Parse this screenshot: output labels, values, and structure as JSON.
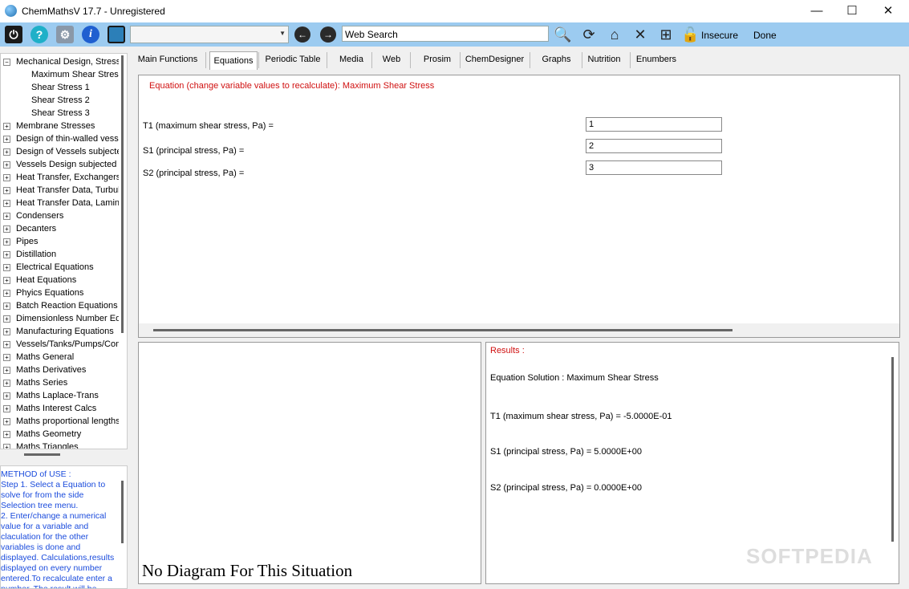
{
  "window": {
    "title": "ChemMathsV 17.7 - Unregistered",
    "minimize": "—",
    "maximize": "☐",
    "close": "✕"
  },
  "toolbar": {
    "search_value": "Web Search",
    "insecure_label": "Insecure",
    "done_label": "Done",
    "icons": [
      "power-icon",
      "help-icon",
      "settings-icon",
      "info-icon",
      "monitor-icon",
      "back-icon",
      "forward-icon",
      "search-icon",
      "refresh-icon",
      "home-icon",
      "stop-icon",
      "new-tab-icon",
      "unlock-icon"
    ],
    "accent": "#9ccbf0"
  },
  "tree": {
    "items": [
      {
        "label": "Mechanical Design, Stress",
        "level": 0,
        "expanded": true
      },
      {
        "label": "Maximum Shear Stress",
        "level": 1
      },
      {
        "label": "Shear Stress 1",
        "level": 1
      },
      {
        "label": "Shear Stress 2",
        "level": 1
      },
      {
        "label": "Shear Stress 3",
        "level": 1
      },
      {
        "label": "Membrane Stresses",
        "level": 0
      },
      {
        "label": "Design of thin-walled vess",
        "level": 0
      },
      {
        "label": "Design of Vessels subjecte",
        "level": 0
      },
      {
        "label": "Vessels Design subjected",
        "level": 0
      },
      {
        "label": "Heat Transfer, Exchangers",
        "level": 0
      },
      {
        "label": "Heat Transfer Data, Turbul",
        "level": 0
      },
      {
        "label": "Heat Transfer Data, Lamina",
        "level": 0
      },
      {
        "label": "Condensers",
        "level": 0
      },
      {
        "label": "Decanters",
        "level": 0
      },
      {
        "label": "Pipes",
        "level": 0
      },
      {
        "label": "Distillation",
        "level": 0
      },
      {
        "label": "Electrical Equations",
        "level": 0
      },
      {
        "label": "Heat Equations",
        "level": 0
      },
      {
        "label": "Phyics Equations",
        "level": 0
      },
      {
        "label": "Batch Reaction Equations",
        "level": 0
      },
      {
        "label": "Dimensionless Number Eq",
        "level": 0
      },
      {
        "label": "Manufacturing Equations",
        "level": 0
      },
      {
        "label": "Vessels/Tanks/Pumps/Com",
        "level": 0
      },
      {
        "label": "Maths General",
        "level": 0
      },
      {
        "label": "Maths Derivatives",
        "level": 0
      },
      {
        "label": "Maths Series",
        "level": 0
      },
      {
        "label": "Maths Laplace-Trans",
        "level": 0
      },
      {
        "label": "Maths Interest Calcs",
        "level": 0
      },
      {
        "label": "Maths proportional lengths",
        "level": 0
      },
      {
        "label": "Maths Geometry",
        "level": 0
      },
      {
        "label": "Maths Triangles",
        "level": 0
      }
    ]
  },
  "method": {
    "lines": [
      "METHOD of USE :",
      "Step 1. Select a Equation to",
      "solve for from the side",
      "Selection tree menu.",
      "2. Enter/change a numerical",
      "value for a variable and",
      "claculation for the other",
      "variables is done and",
      "displayed. Calculations,results",
      "displayed on every number",
      "entered.To recalculate enter a",
      "number. The result will be"
    ]
  },
  "tabs": [
    "Main Functions",
    "Equations",
    "Periodic Table",
    "Media",
    "Web",
    "Prosim",
    "ChemDesigner",
    "Graphs",
    "Nutrition",
    "Enumbers"
  ],
  "active_tab": "Equations",
  "equation": {
    "header": "Equation (change variable values to recalculate): Maximum Shear Stress",
    "fields": [
      {
        "label": "T1 (maximum shear stress, Pa) =",
        "value": "1"
      },
      {
        "label": "S1 (principal stress, Pa) =",
        "value": "2"
      },
      {
        "label": "S2 (principal stress, Pa) =",
        "value": "3"
      }
    ]
  },
  "diagram": {
    "text": "No Diagram For This Situation"
  },
  "results": {
    "title": "Results :",
    "solution": "Equation Solution : Maximum Shear Stress",
    "lines": [
      "T1 (maximum shear stress, Pa) =  -5.0000E-01",
      "S1 (principal stress, Pa) =  5.0000E+00",
      "S2 (principal stress, Pa) =  0.0000E+00"
    ]
  },
  "watermark": "SOFTPEDIA"
}
